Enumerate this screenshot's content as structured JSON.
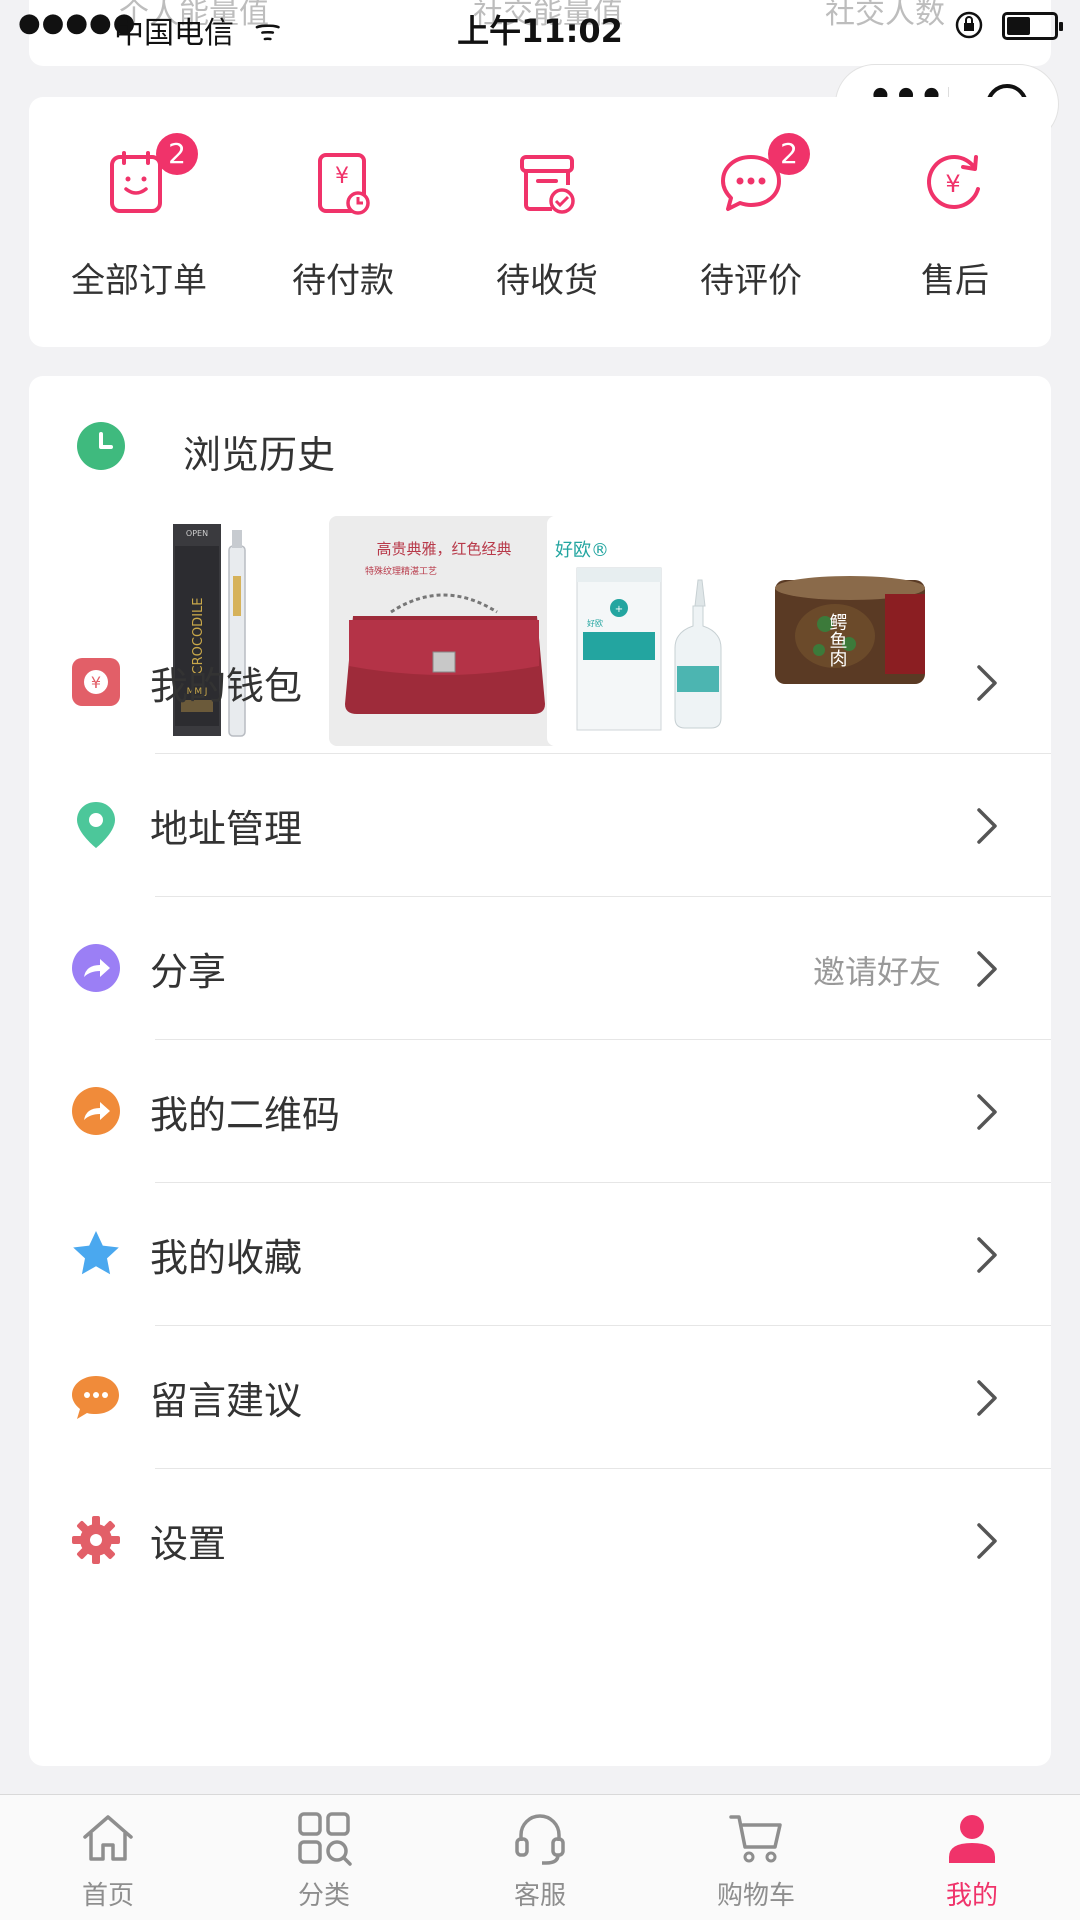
{
  "status_bar": {
    "signal": "●●●●●",
    "carrier": "中国电信",
    "wifi": "ᯤ",
    "time": "上午11:02",
    "battery_level": 0.5
  },
  "scrolled_stats": [
    "个人能量值",
    "社交能量值",
    "社交人数"
  ],
  "capsule": {
    "more": "•••"
  },
  "orders": [
    {
      "label": "全部订单",
      "icon": "order-list-icon",
      "badge": "2"
    },
    {
      "label": "待付款",
      "icon": "pending-payment-icon",
      "badge": ""
    },
    {
      "label": "待收货",
      "icon": "pending-receipt-icon",
      "badge": ""
    },
    {
      "label": "待评价",
      "icon": "pending-review-icon",
      "badge": "2"
    },
    {
      "label": "售后",
      "icon": "after-sales-icon",
      "badge": ""
    }
  ],
  "history": {
    "title": "浏览历史",
    "items": [
      {
        "name": "crocodile-serum",
        "texts": [
          "OPEN",
          "CROCODILE",
          "MMJJ"
        ]
      },
      {
        "name": "red-handbag",
        "texts": [
          "高贵典雅，红色经典",
          "特殊纹理精湛工艺"
        ]
      },
      {
        "name": "haoou-care-liquid",
        "texts": [
          "好欧®",
          "好欧"
        ]
      },
      {
        "name": "canned-fish",
        "texts": [
          "鳄鱼肉"
        ]
      }
    ]
  },
  "menu": [
    {
      "label": "我的钱包",
      "icon": "wallet-icon",
      "right": ""
    },
    {
      "label": "地址管理",
      "icon": "location-pin-icon",
      "right": ""
    },
    {
      "label": "分享",
      "icon": "share-icon",
      "right": "邀请好友"
    },
    {
      "label": "我的二维码",
      "icon": "qrcode-share-icon",
      "right": ""
    },
    {
      "label": "我的收藏",
      "icon": "star-icon",
      "right": ""
    },
    {
      "label": "留言建议",
      "icon": "message-icon",
      "right": ""
    },
    {
      "label": "设置",
      "icon": "gear-icon",
      "right": ""
    }
  ],
  "tabs": [
    {
      "label": "首页",
      "icon": "home-icon",
      "active": false
    },
    {
      "label": "分类",
      "icon": "category-icon",
      "active": false
    },
    {
      "label": "客服",
      "icon": "headset-icon",
      "active": false
    },
    {
      "label": "购物车",
      "icon": "cart-icon",
      "active": false
    },
    {
      "label": "我的",
      "icon": "user-icon",
      "active": true
    }
  ],
  "colors": {
    "accent": "#f0336a",
    "history_icon": "#3fba7e",
    "wallet": "#e25f68",
    "location": "#4cc79a",
    "share": "#9b7ff5",
    "qrcode": "#f08b3a",
    "star": "#4aa8ef",
    "message": "#f08b3a",
    "settings": "#e25f68"
  }
}
